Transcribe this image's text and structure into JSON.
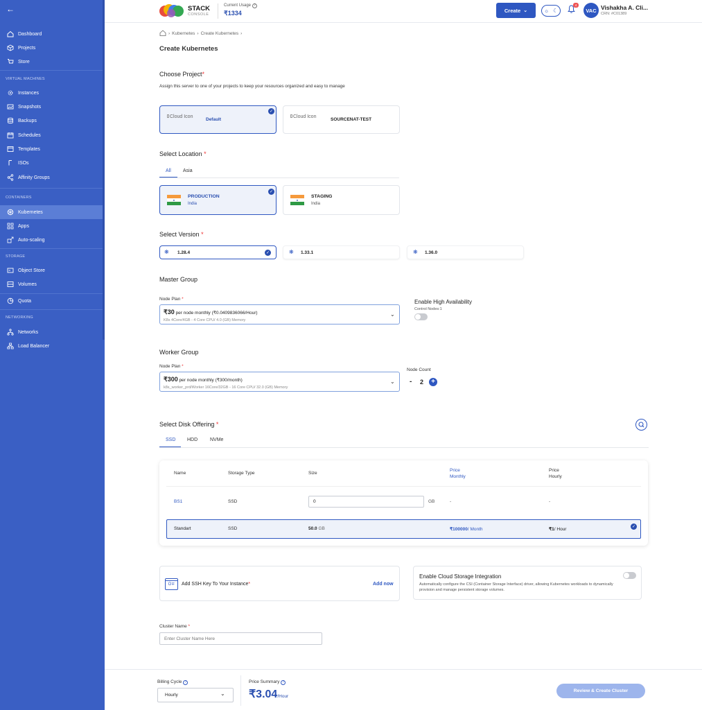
{
  "sidebar": {
    "items_top": [
      {
        "label": "Dashboard"
      },
      {
        "label": "Projects"
      },
      {
        "label": "Store"
      }
    ],
    "section_vm": "VIRTUAL MACHINES",
    "items_vm": [
      {
        "label": "Instances"
      },
      {
        "label": "Snapshots"
      },
      {
        "label": "Backups"
      },
      {
        "label": "Schedules"
      },
      {
        "label": "Templates"
      },
      {
        "label": "ISOs"
      },
      {
        "label": "Affinity Groups"
      }
    ],
    "section_containers": "CONTAINERS",
    "items_containers": [
      {
        "label": "Kubernetes"
      },
      {
        "label": "Apps"
      },
      {
        "label": "Auto-scaling"
      }
    ],
    "section_storage": "STORAGE",
    "items_storage": [
      {
        "label": "Object Store"
      },
      {
        "label": "Volumes"
      }
    ],
    "quota": "Quota",
    "section_networking": "NETWORKING",
    "items_networking": [
      {
        "label": "Networks"
      },
      {
        "label": "Load Balancer"
      }
    ]
  },
  "header": {
    "logo_title": "STACK",
    "logo_sub": "CONSOLE",
    "usage_label": "Current Usage",
    "usage_value": "₹1334",
    "create_label": "Create",
    "notif_count": "4",
    "avatar_initials": "VAC",
    "user_name": "Vishakha A. Cli...",
    "user_crn": "CRN: #C01389"
  },
  "breadcrumb": {
    "items": [
      "Kubernetes",
      "Create Kubernetes"
    ]
  },
  "page_title": "Create Kubernetes",
  "project": {
    "heading": "Choose Project",
    "description": "Assign this server to one of your projects to keep your resources organized and easy to manage",
    "cards": [
      {
        "img_alt": "Cloud Icon",
        "name": "Default",
        "selected": true
      },
      {
        "img_alt": "Cloud Icon",
        "name": "SOURCENAT-TEST",
        "selected": false
      }
    ]
  },
  "location": {
    "heading": "Select Location",
    "tabs": [
      "All",
      "Asia"
    ],
    "cards": [
      {
        "name": "PRODUCTION",
        "country": "India",
        "selected": true
      },
      {
        "name": "STAGING",
        "country": "India",
        "selected": false
      }
    ]
  },
  "version": {
    "heading": "Select Version",
    "options": [
      {
        "label": "1.28.4",
        "selected": true
      },
      {
        "label": "1.33.1",
        "selected": false
      },
      {
        "label": "1.36.0",
        "selected": false
      }
    ]
  },
  "master": {
    "heading": "Master Group",
    "node_plan_label": "Node Plan",
    "plan_price": "₹30",
    "plan_rest": "per node monthly (₹0.0409836066/Hour)",
    "plan_desc": "K8s 4Core/4GB - 4 Core CPU/ 4.0 (GB) Memory",
    "ha_label": "Enable High Availability",
    "ha_sub": "Control Nodes:1"
  },
  "worker": {
    "heading": "Worker Group",
    "node_plan_label": "Node Plan",
    "plan_price": "₹300",
    "plan_rest": "per node monthly (₹300/month)",
    "plan_desc": "k8s_worker_prd/Worker 16Core/32GB - 16 Core CPU/ 32.0 (GB) Memory",
    "node_count_label": "Node Count",
    "minus": "-",
    "count": "2",
    "plus": "+"
  },
  "disk": {
    "heading": "Select Disk Offering",
    "tabs": [
      "SSD",
      "HDD",
      "NVMe"
    ],
    "columns": {
      "name": "Name",
      "storage_type": "Storage Type",
      "size": "Size",
      "price": "Price",
      "price_monthly": "Monthly",
      "price2": "Price",
      "price_hourly": "Hourly"
    },
    "rows": [
      {
        "name": "BS1",
        "type": "SSD",
        "size_input": "0",
        "size_unit": "GB",
        "monthly": "-",
        "hourly": "-"
      },
      {
        "name": "Standart",
        "type": "SSD",
        "size_value": "50.0",
        "size_unit": "GB",
        "monthly": "₹100000",
        "monthly_unit": "/ Month",
        "hourly": "₹1",
        "hourly_unit": "/ Hour",
        "selected": true
      }
    ]
  },
  "ssh": {
    "label": "Add SSH Key To Your Instance",
    "add_now": "Add now"
  },
  "cloud_storage": {
    "title": "Enable Cloud Storage Integration",
    "desc": "Automatically configure the CSI (Container Storage Interface) driver, allowing Kubernetes workloads to dynamically provision and manage persistent storage volumes."
  },
  "cluster": {
    "label": "Cluster Name",
    "placeholder": "Enter Cluster Name Here"
  },
  "footer": {
    "billing_label": "Billing Cycle",
    "billing_value": "Hourly",
    "price_label": "Price Summary",
    "price_value": "₹3.04",
    "price_unit": "/Hour",
    "submit": "Review & Create Cluster"
  },
  "colors": {
    "brand": "#2e57c1",
    "sidebar": "#3a5fc4",
    "required": "#e33333"
  }
}
